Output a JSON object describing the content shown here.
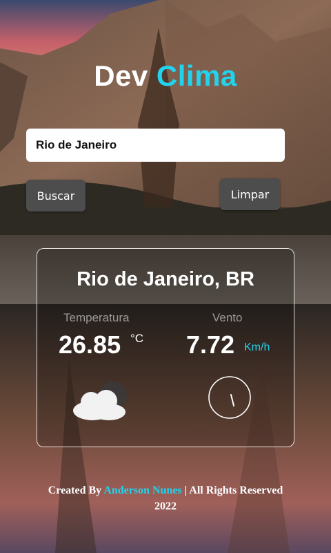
{
  "header": {
    "title_part1": "Dev",
    "title_part2": "Clima",
    "accent_color": "#22d3ee"
  },
  "search": {
    "value": "Rio de Janeiro",
    "placeholder": ""
  },
  "buttons": {
    "search_label": "Buscar",
    "clear_label": "Limpar"
  },
  "weather": {
    "location": "Rio de Janeiro, BR",
    "temperature_label": "Temperatura",
    "temperature_value": "26.85",
    "temperature_unit": "°C",
    "wind_label": "Vento",
    "wind_value": "7.72",
    "wind_unit": "Km/h",
    "condition_icon": "cloud-icon",
    "wind_direction_icon": "compass-icon"
  },
  "footer": {
    "prefix": "Created By",
    "author": "Anderson Nunes",
    "suffix": "| All Rights Reserved",
    "year": "2022"
  }
}
